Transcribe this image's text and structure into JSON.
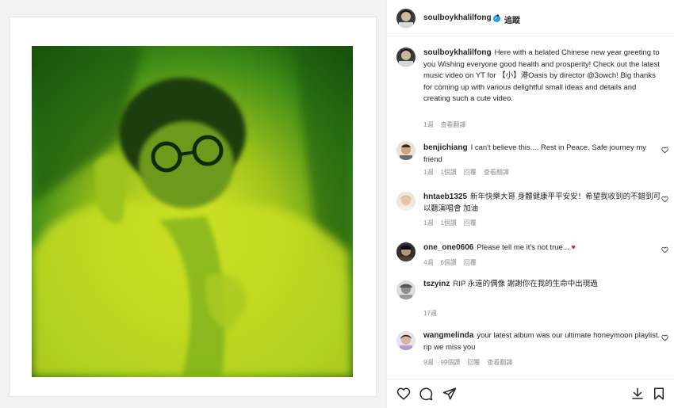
{
  "post": {
    "username": "soulboykhalilfong",
    "follow_label": "追蹤",
    "separator": "•",
    "caption": "Here with a belated Chinese new year greeting to you Wishing everyone good health and prosperity! Check out the latest music video on YT for 【小】港Oasis by director @3owch! Big thanks for coming up with various delightful small ideas and details and creating such a cute video.",
    "caption_meta": {
      "time": "1週",
      "translate": "查看翻譯"
    }
  },
  "comments": [
    {
      "username": "benjichiang",
      "text": "I can't believe this.... Rest in Peace. Safe journey my friend",
      "time": "1週",
      "likes": "1個讚",
      "reply": "回覆",
      "translate": "查看翻譯"
    },
    {
      "username": "hntaeb1325",
      "text": "新年快樂大哥 身體健康平平安安！希望我收到的不錯到可以聽演唱會 加油",
      "time": "1週",
      "likes": "1個讚",
      "reply": "回覆"
    },
    {
      "username": "one_one0606",
      "text": "Please tell me it's not true...",
      "time": "4週",
      "likes": "6個讚",
      "reply": "回覆"
    },
    {
      "username": "tszyinz",
      "text": "RIP 永遠的偶像 謝謝你在我的生命中出現過",
      "time": "17週"
    },
    {
      "username": "wangmelinda",
      "text": "your latest album was our ultimate honeymoon playlist. rip we miss you",
      "time": "9週",
      "likes": "99個讚",
      "reply": "回覆",
      "translate": "查看翻譯"
    }
  ],
  "icons": {
    "like": "heart-outline-icon",
    "comment": "comment-bubble-icon",
    "share": "paper-plane-icon",
    "download": "download-icon",
    "save": "bookmark-icon"
  },
  "colors": {
    "photo_green": "#3f8f18",
    "photo_yellow": "#d6e61a",
    "verified": "#1d9bf0",
    "muted_text": "#8e8e8e"
  }
}
